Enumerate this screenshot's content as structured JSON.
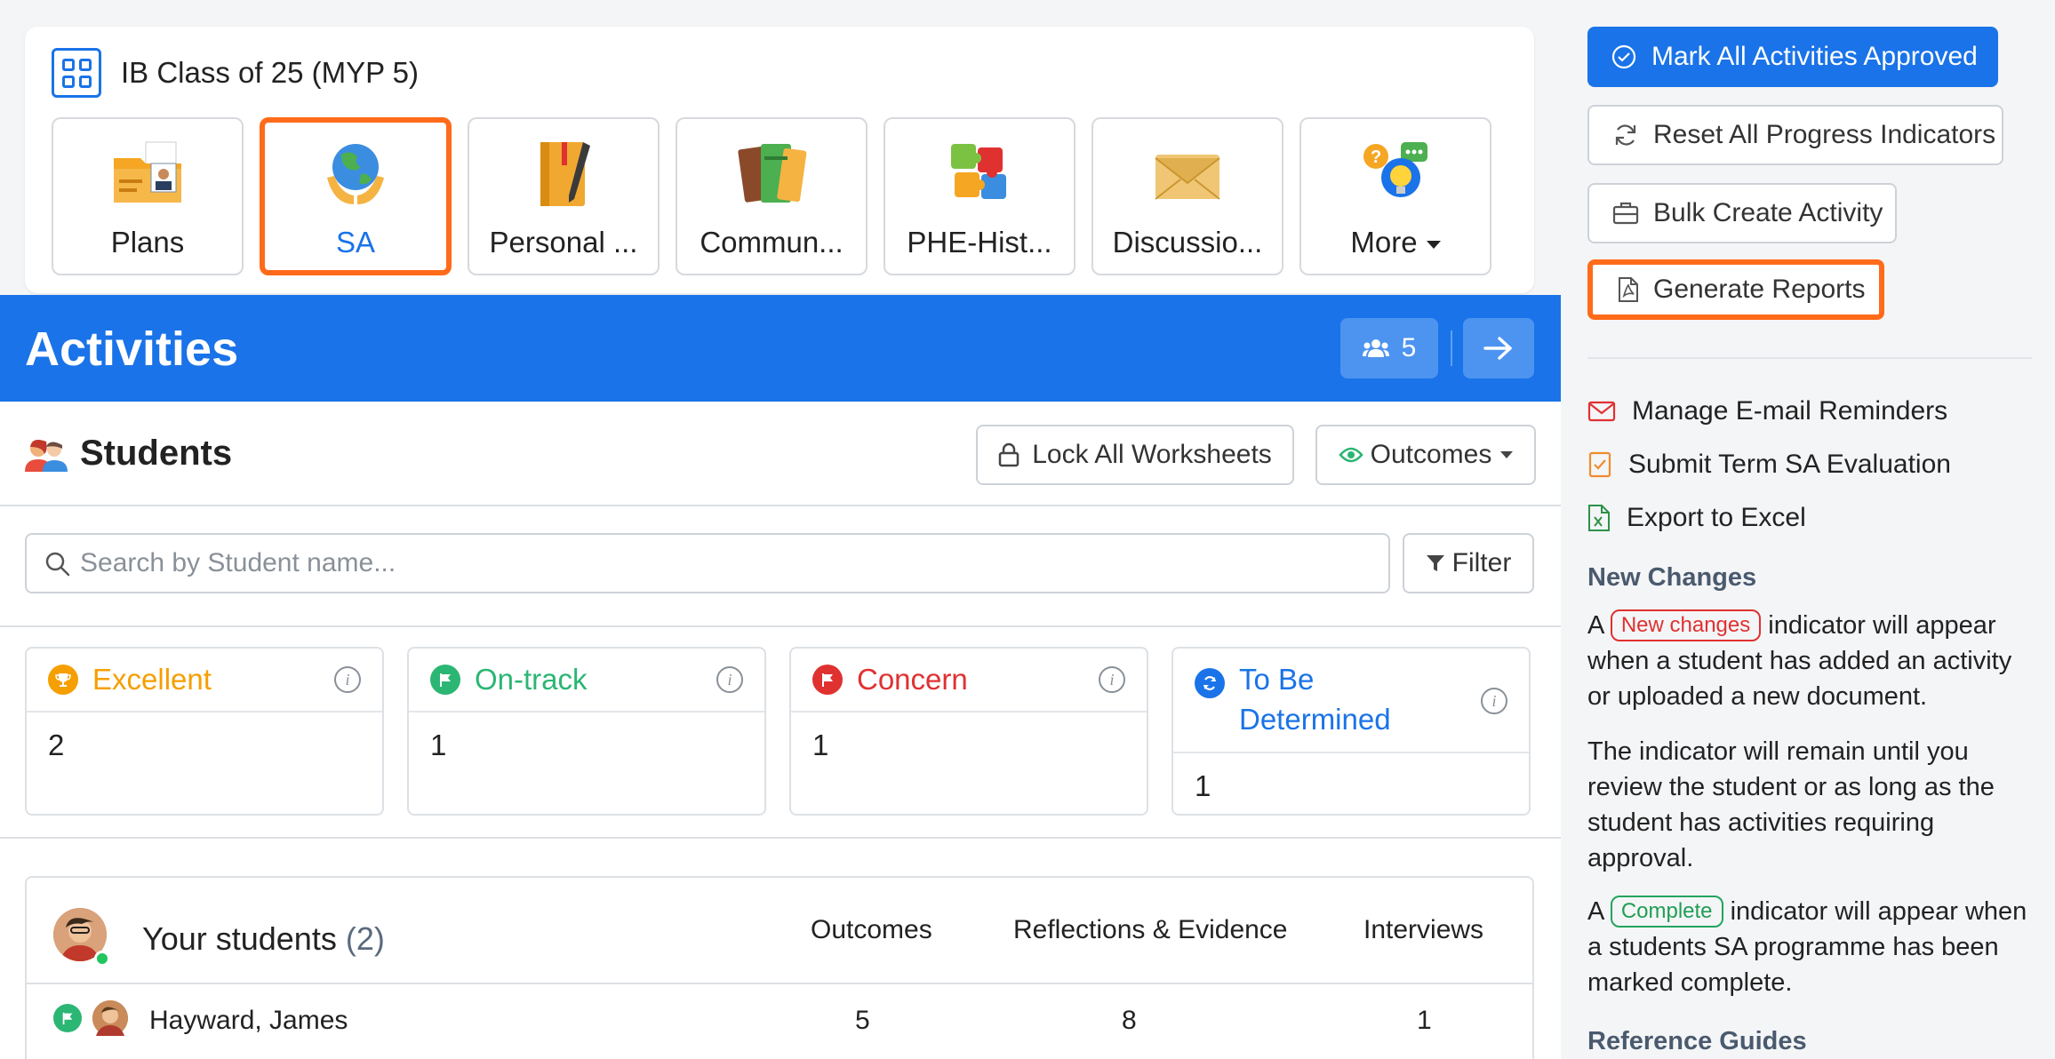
{
  "class": {
    "title": "IB Class of 25 (MYP 5)",
    "tiles": [
      {
        "label": "Plans",
        "icon": "folder-profile-icon"
      },
      {
        "label": "SA",
        "icon": "globe-hands-icon",
        "active": true
      },
      {
        "label": "Personal ...",
        "icon": "notebook-pen-icon"
      },
      {
        "label": "Commun...",
        "icon": "books-icon"
      },
      {
        "label": "PHE-Hist...",
        "icon": "puzzle-icon"
      },
      {
        "label": "Discussio...",
        "icon": "envelope-icon"
      },
      {
        "label": "More",
        "icon": "idea-chat-icon"
      }
    ]
  },
  "activities": {
    "title": "Activities",
    "student_count": "5"
  },
  "students": {
    "title": "Students",
    "lock_label": "Lock All Worksheets",
    "outcomes_label": "Outcomes",
    "search_placeholder": "Search by Student name...",
    "filter_label": "Filter"
  },
  "status_cards": [
    {
      "label": "Excellent",
      "value": "2",
      "color": "#f59f00"
    },
    {
      "label": "On-track",
      "value": "1",
      "color": "#2bb673"
    },
    {
      "label": "Concern",
      "value": "1",
      "color": "#e03131"
    },
    {
      "label": "To Be Determined",
      "value": "1",
      "color": "#1a73e8"
    }
  ],
  "your_students": {
    "title": "Your students",
    "count": "(2)",
    "columns": [
      "Outcomes",
      "Reflections & Evidence",
      "Interviews"
    ],
    "rows": [
      {
        "name": "Hayward, James",
        "outcomes": "5",
        "reflections": "8",
        "interviews": "1"
      }
    ]
  },
  "sidebar": {
    "mark_all": "Mark All Activities Approved",
    "reset_all": "Reset All Progress Indicators",
    "bulk_create": "Bulk Create Activity",
    "generate_reports": "Generate Reports",
    "links": [
      "Manage E-mail Reminders",
      "Submit Term SA Evaluation",
      "Export to Excel"
    ],
    "new_changes_heading": "New Changes",
    "p1_prefix": "A",
    "p1_badge": "New changes",
    "p1_suffix": "indicator will appear when a student has added an activity or uploaded a new document.",
    "p2": "The indicator will remain until you review the student or as long as the student has activities requiring approval.",
    "p3_prefix": "A",
    "p3_badge": "Complete",
    "p3_suffix": "indicator will appear when a students SA programme has been marked complete.",
    "reference_heading": "Reference Guides"
  },
  "colors": {
    "primary": "#1a73e8",
    "highlight": "#ff6b1a"
  }
}
